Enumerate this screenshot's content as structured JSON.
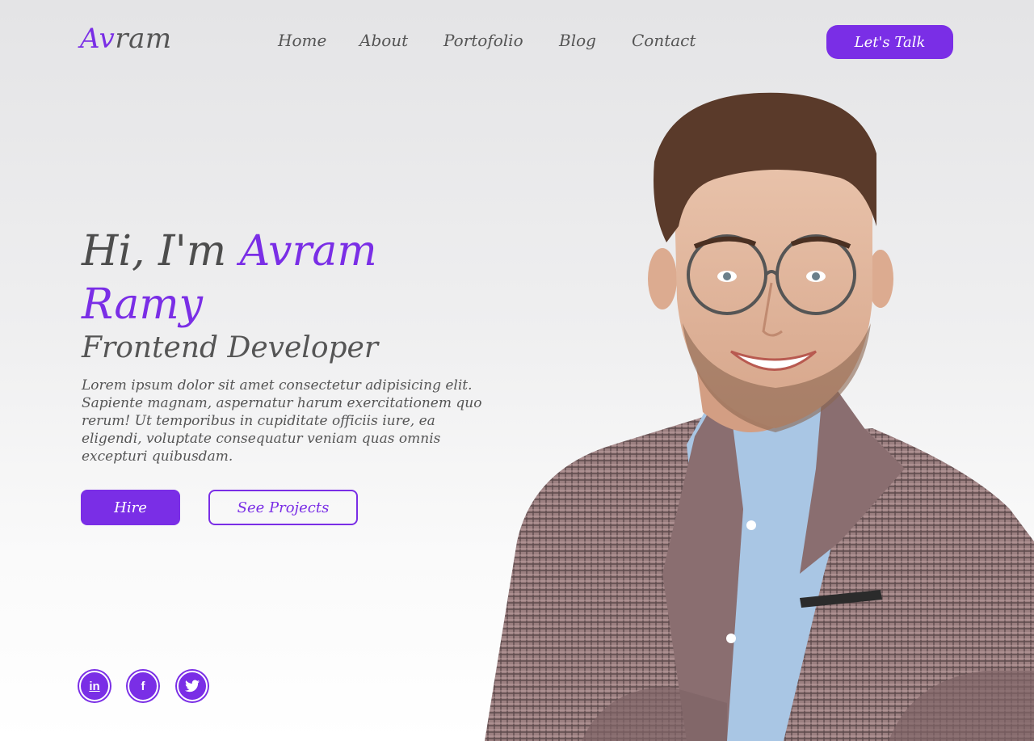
{
  "logo": {
    "part1": "Av",
    "part2": "ram"
  },
  "nav": {
    "items": [
      "Home",
      "About",
      "Portofolio",
      "Blog",
      "Contact"
    ]
  },
  "cta": {
    "talk_label": "Let's Talk"
  },
  "hero": {
    "greeting": "Hi, I'm ",
    "name_first": "Avram",
    "name_last": "Ramy",
    "role": "Frontend Developer",
    "description": "Lorem ipsum dolor sit amet consectetur adipisicing elit. Sapiente magnam, aspernatur harum exercitationem quo rerum! Ut temporibus in cupiditate officiis iure, ea eligendi, voluptate consequatur veniam quas omnis excepturi quibusdam.",
    "hire_label": "Hire",
    "projects_label": "See Projects"
  },
  "social": [
    {
      "icon": "linkedin-icon",
      "glyph": "in"
    },
    {
      "icon": "facebook-icon",
      "glyph": "f"
    },
    {
      "icon": "twitter-icon",
      "glyph": "t"
    }
  ],
  "colors": {
    "accent": "#7a2ee6",
    "text": "#555555"
  }
}
